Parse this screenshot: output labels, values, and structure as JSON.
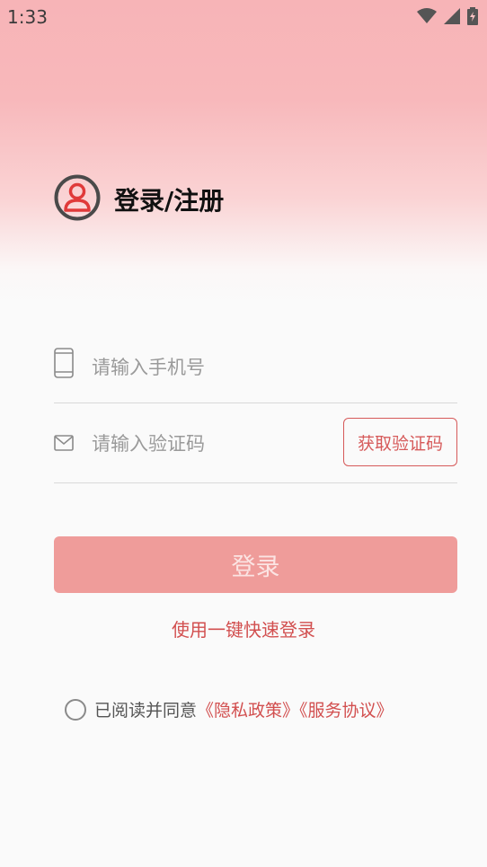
{
  "status_bar": {
    "time": "1:33",
    "icons": [
      "wifi-icon",
      "signal-icon",
      "battery-icon"
    ]
  },
  "header": {
    "avatar_icon": "user-circle-icon",
    "title": "登录/注册"
  },
  "phone_field": {
    "icon": "phone-icon",
    "placeholder": "请输入手机号",
    "value": ""
  },
  "code_field": {
    "icon": "mail-icon",
    "placeholder": "请输入验证码",
    "value": "",
    "get_code_label": "获取验证码"
  },
  "login_button": {
    "label": "登录"
  },
  "quick_login": {
    "label": "使用一键快速登录"
  },
  "agreement": {
    "checked": false,
    "text": "已阅读并同意",
    "privacy_link": "《隐私政策》",
    "service_link": "《服务协议》"
  },
  "colors": {
    "accent": "#d24f4f",
    "login_button_bg": "#ef9c9a",
    "gradient_top": "#f7b4b7",
    "background": "#fafafa"
  }
}
